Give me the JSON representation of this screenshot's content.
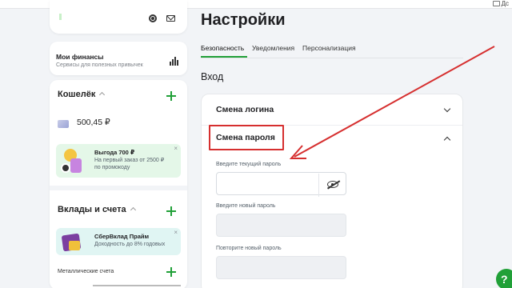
{
  "browser": {
    "folder_label": "Дс"
  },
  "sidebar": {
    "finance": {
      "title": "Мои финансы",
      "subtitle": "Сервисы для полезных привычек"
    },
    "wallet": {
      "title": "Кошелёк",
      "balance": "500,45 ₽"
    },
    "promo1": {
      "title": "Выгода 700 ₽",
      "line1": "На первый заказ от 2500 ₽",
      "line2": "по промокоду",
      "close": "×"
    },
    "deposits": {
      "title": "Вклады и счета"
    },
    "promo2": {
      "title": "СберВклад Прайм",
      "line1": "Доходность до 8% годовых",
      "close": "×"
    },
    "metal": {
      "title": "Металлические счета"
    }
  },
  "page": {
    "title": "Настройки",
    "tabs": [
      {
        "label": "Безопасность",
        "active": true
      },
      {
        "label": "Уведомления",
        "active": false
      },
      {
        "label": "Персонализация",
        "active": false
      }
    ],
    "section_title": "Вход",
    "login_change": "Смена логина",
    "password_change": "Смена пароля",
    "fields": [
      {
        "label": "Введите текущий пароль",
        "value": ""
      },
      {
        "label": "Введите новый пароль",
        "value": ""
      },
      {
        "label": "Повторите новый пароль",
        "value": ""
      }
    ]
  },
  "help": {
    "label": "?"
  },
  "colors": {
    "accent": "#21a038",
    "annotation": "#d62f2f"
  }
}
